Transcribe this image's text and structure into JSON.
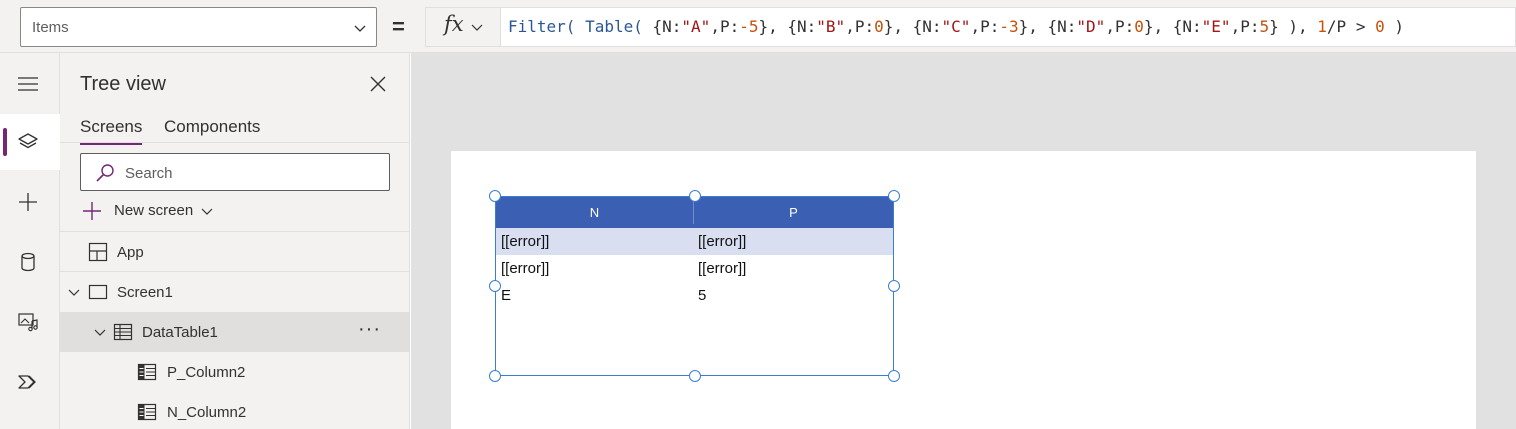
{
  "formula_bar": {
    "property": "Items",
    "equals": "=",
    "fx": "fx",
    "formula_tokens": [
      {
        "t": "Filter(",
        "k": "fn"
      },
      {
        "t": " ",
        "k": "txt"
      },
      {
        "t": "Table(",
        "k": "fn"
      },
      {
        "t": " {N:",
        "k": "txt"
      },
      {
        "t": "\"A\"",
        "k": "str"
      },
      {
        "t": ",P:",
        "k": "txt"
      },
      {
        "t": "-5",
        "k": "num"
      },
      {
        "t": "}, {N:",
        "k": "txt"
      },
      {
        "t": "\"B\"",
        "k": "str"
      },
      {
        "t": ",P:",
        "k": "txt"
      },
      {
        "t": "0",
        "k": "num"
      },
      {
        "t": "}, {N:",
        "k": "txt"
      },
      {
        "t": "\"C\"",
        "k": "str"
      },
      {
        "t": ",P:",
        "k": "txt"
      },
      {
        "t": "-3",
        "k": "num"
      },
      {
        "t": "}, {N:",
        "k": "txt"
      },
      {
        "t": "\"D\"",
        "k": "str"
      },
      {
        "t": ",P:",
        "k": "txt"
      },
      {
        "t": "0",
        "k": "num"
      },
      {
        "t": "}, {N:",
        "k": "txt"
      },
      {
        "t": "\"E\"",
        "k": "str"
      },
      {
        "t": ",P:",
        "k": "txt"
      },
      {
        "t": "5",
        "k": "num"
      },
      {
        "t": "} ), ",
        "k": "txt"
      },
      {
        "t": "1",
        "k": "num"
      },
      {
        "t": "/P > ",
        "k": "txt"
      },
      {
        "t": "0",
        "k": "num"
      },
      {
        "t": " )",
        "k": "txt"
      }
    ]
  },
  "rail": {
    "items": [
      {
        "icon": "hamburger-menu-icon",
        "active": false
      },
      {
        "icon": "layers-icon",
        "active": true
      },
      {
        "icon": "plus-icon",
        "active": false
      },
      {
        "icon": "data-cylinder-icon",
        "active": false
      },
      {
        "icon": "media-icon",
        "active": false
      },
      {
        "icon": "power-automate-icon",
        "active": false
      }
    ]
  },
  "tree": {
    "title": "Tree view",
    "tabs": [
      {
        "label": "Screens",
        "active": true
      },
      {
        "label": "Components",
        "active": false
      }
    ],
    "search_placeholder": "Search",
    "new_screen_label": "New screen",
    "nodes": {
      "app": "App",
      "screen1": "Screen1",
      "datatable1": "DataTable1",
      "more": "···",
      "p_column2": "P_Column2",
      "n_column2": "N_Column2"
    }
  },
  "datatable": {
    "headers": [
      "N",
      "P"
    ],
    "rows": [
      {
        "n": "[[error]]",
        "p": "[[error]]",
        "selected": true
      },
      {
        "n": "[[error]]",
        "p": "[[error]]",
        "selected": false
      },
      {
        "n": "E",
        "p": "5",
        "selected": false
      }
    ]
  },
  "colors": {
    "accent": "#742774",
    "header_blue": "#3a5fb3",
    "selection_blue": "#3b7ed6",
    "selected_row": "#d9def1"
  }
}
